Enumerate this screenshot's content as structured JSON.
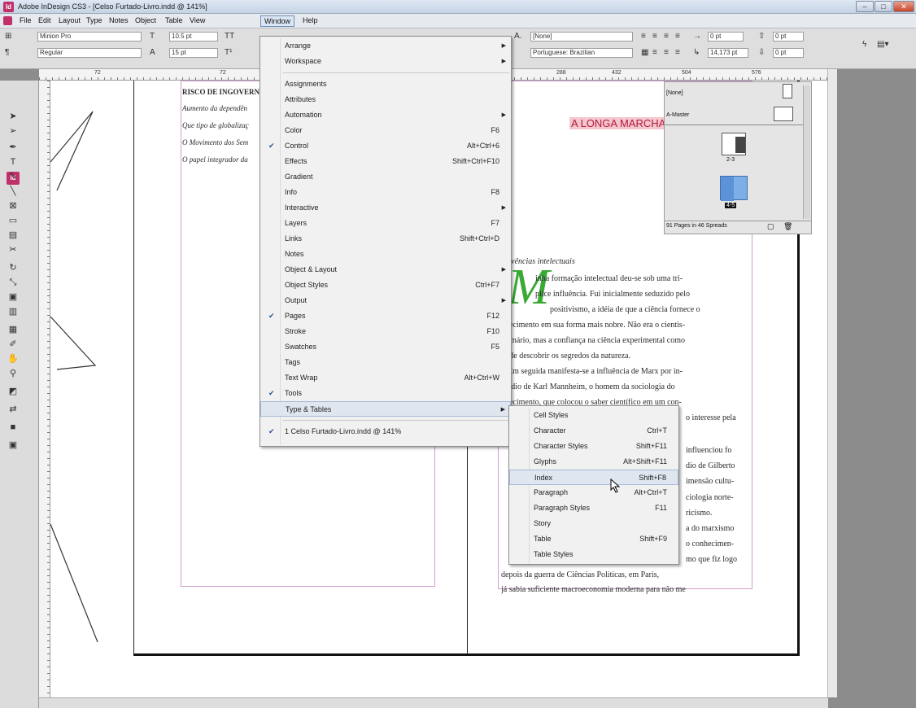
{
  "window": {
    "title": "Adobe InDesign CS3 - [Celso Furtado-Livro.indd @ 141%]",
    "app_icon": "Id",
    "min": "–",
    "max": "□",
    "close": "✕"
  },
  "menubar": {
    "items": [
      {
        "label": "File"
      },
      {
        "label": "Edit"
      },
      {
        "label": "Layout"
      },
      {
        "label": "Type"
      },
      {
        "label": "Notes"
      },
      {
        "label": "Object"
      },
      {
        "label": "Table"
      },
      {
        "label": "View"
      },
      {
        "label": "Window"
      },
      {
        "label": "Help"
      }
    ],
    "active": "Window"
  },
  "control": {
    "font_family": "Minion Pro",
    "font_style": "Regular",
    "font_size": "10.5 pt",
    "leading": "15 pt",
    "char_style": "[None]",
    "language": "Portuguese: Brazilian",
    "indent_left": "0 pt",
    "indent_first": "14,173 pt",
    "space_before": "0 pt",
    "space_after": "0 pt",
    "indent_right": "0 pt",
    "space_after2": "0 pt"
  },
  "ruler": {
    "marks": [
      "72",
      "72",
      "288",
      "432",
      "504",
      "576"
    ]
  },
  "document": {
    "left_page": {
      "heading": "RISCO DE INGOVERN",
      "lines": [
        "Aumento da dependên",
        "Que tipo de globalizaç",
        "O Movimento dos Sem",
        "O papel integrador da"
      ]
    },
    "right_page": {
      "title": "A LONGA MARCHA",
      "section": "Vivências intelectuais",
      "dropcap": "M",
      "lines": [
        "inha formação intelectual deu-se sob uma tri-",
        "plice influência. Fui inicialmente seduzido pelo",
        "positivismo, a idéia de que a ciência fornece o",
        "nhecimento em sua forma mais nobre. Não era o cientis-",
        "primário, mas a confiança na ciência experimental como",
        "io de descobrir os segredos da natureza.",
        "Em seguida manifesta-se a influência de Marx por in-",
        "médio de Karl Mannheim, o homem da sociologia do",
        "nhecimento, que colocou o saber científico em um con-",
        "o interesse pela",
        "influenciou fo",
        "dio de Gilberto",
        "imensão cultu-",
        "ciologia norte-",
        "ricismo.",
        "a do marxismo",
        "o conhecimen-",
        "mo que fiz logo",
        "depois da guerra de Ciências Políticas, em Paris,",
        "já sabia suficiente macroeconomia moderna para não me"
      ]
    }
  },
  "window_menu": {
    "items": [
      {
        "label": "Arrange",
        "shortcut": "",
        "submenu": true,
        "checked": false
      },
      {
        "label": "Workspace",
        "shortcut": "",
        "submenu": true,
        "checked": false
      },
      {
        "sep": true
      },
      {
        "label": "Assignments",
        "shortcut": "",
        "submenu": false,
        "checked": false
      },
      {
        "label": "Attributes",
        "shortcut": "",
        "submenu": false,
        "checked": false
      },
      {
        "label": "Automation",
        "shortcut": "",
        "submenu": true,
        "checked": false
      },
      {
        "label": "Color",
        "shortcut": "F6",
        "submenu": false,
        "checked": false
      },
      {
        "label": "Control",
        "shortcut": "Alt+Ctrl+6",
        "submenu": false,
        "checked": true
      },
      {
        "label": "Effects",
        "shortcut": "Shift+Ctrl+F10",
        "submenu": false,
        "checked": false
      },
      {
        "label": "Gradient",
        "shortcut": "",
        "submenu": false,
        "checked": false
      },
      {
        "label": "Info",
        "shortcut": "F8",
        "submenu": false,
        "checked": false
      },
      {
        "label": "Interactive",
        "shortcut": "",
        "submenu": true,
        "checked": false
      },
      {
        "label": "Layers",
        "shortcut": "F7",
        "submenu": false,
        "checked": false
      },
      {
        "label": "Links",
        "shortcut": "Shift+Ctrl+D",
        "submenu": false,
        "checked": false
      },
      {
        "label": "Notes",
        "shortcut": "",
        "submenu": false,
        "checked": false
      },
      {
        "label": "Object & Layout",
        "shortcut": "",
        "submenu": true,
        "checked": false
      },
      {
        "label": "Object Styles",
        "shortcut": "Ctrl+F7",
        "submenu": false,
        "checked": false
      },
      {
        "label": "Output",
        "shortcut": "",
        "submenu": true,
        "checked": false
      },
      {
        "label": "Pages",
        "shortcut": "F12",
        "submenu": false,
        "checked": true
      },
      {
        "label": "Stroke",
        "shortcut": "F10",
        "submenu": false,
        "checked": false
      },
      {
        "label": "Swatches",
        "shortcut": "F5",
        "submenu": false,
        "checked": false
      },
      {
        "label": "Tags",
        "shortcut": "",
        "submenu": false,
        "checked": false
      },
      {
        "label": "Text Wrap",
        "shortcut": "Alt+Ctrl+W",
        "submenu": false,
        "checked": false
      },
      {
        "label": "Tools",
        "shortcut": "",
        "submenu": false,
        "checked": true
      },
      {
        "label": "Type & Tables",
        "shortcut": "",
        "submenu": true,
        "checked": false,
        "highlight": true
      },
      {
        "sep": true
      },
      {
        "label": "1 Celso Furtado-Livro.indd @ 141%",
        "shortcut": "",
        "submenu": false,
        "checked": true
      }
    ]
  },
  "type_tables_menu": {
    "items": [
      {
        "label": "Cell Styles",
        "shortcut": ""
      },
      {
        "label": "Character",
        "shortcut": "Ctrl+T"
      },
      {
        "label": "Character Styles",
        "shortcut": "Shift+F11"
      },
      {
        "label": "Glyphs",
        "shortcut": "Alt+Shift+F11"
      },
      {
        "label": "Index",
        "shortcut": "Shift+F8",
        "highlight": true
      },
      {
        "label": "Paragraph",
        "shortcut": "Alt+Ctrl+T"
      },
      {
        "label": "Paragraph Styles",
        "shortcut": "F11"
      },
      {
        "label": "Story",
        "shortcut": ""
      },
      {
        "label": "Table",
        "shortcut": "Shift+F9"
      },
      {
        "label": "Table Styles",
        "shortcut": ""
      }
    ]
  },
  "pages_panel": {
    "none_label": "[None]",
    "master_label": "A-Master",
    "spread1_label": "2-3",
    "spread2_label": "4-5",
    "status": "91 Pages in 46 Spreads"
  },
  "colors": {
    "accent": "#c0306a",
    "menu_highlight": "#dfe6f0",
    "dropcap": "#3aaa35",
    "title_highlight": "#f6c6cf",
    "margin_guide": "#d19ed0"
  }
}
